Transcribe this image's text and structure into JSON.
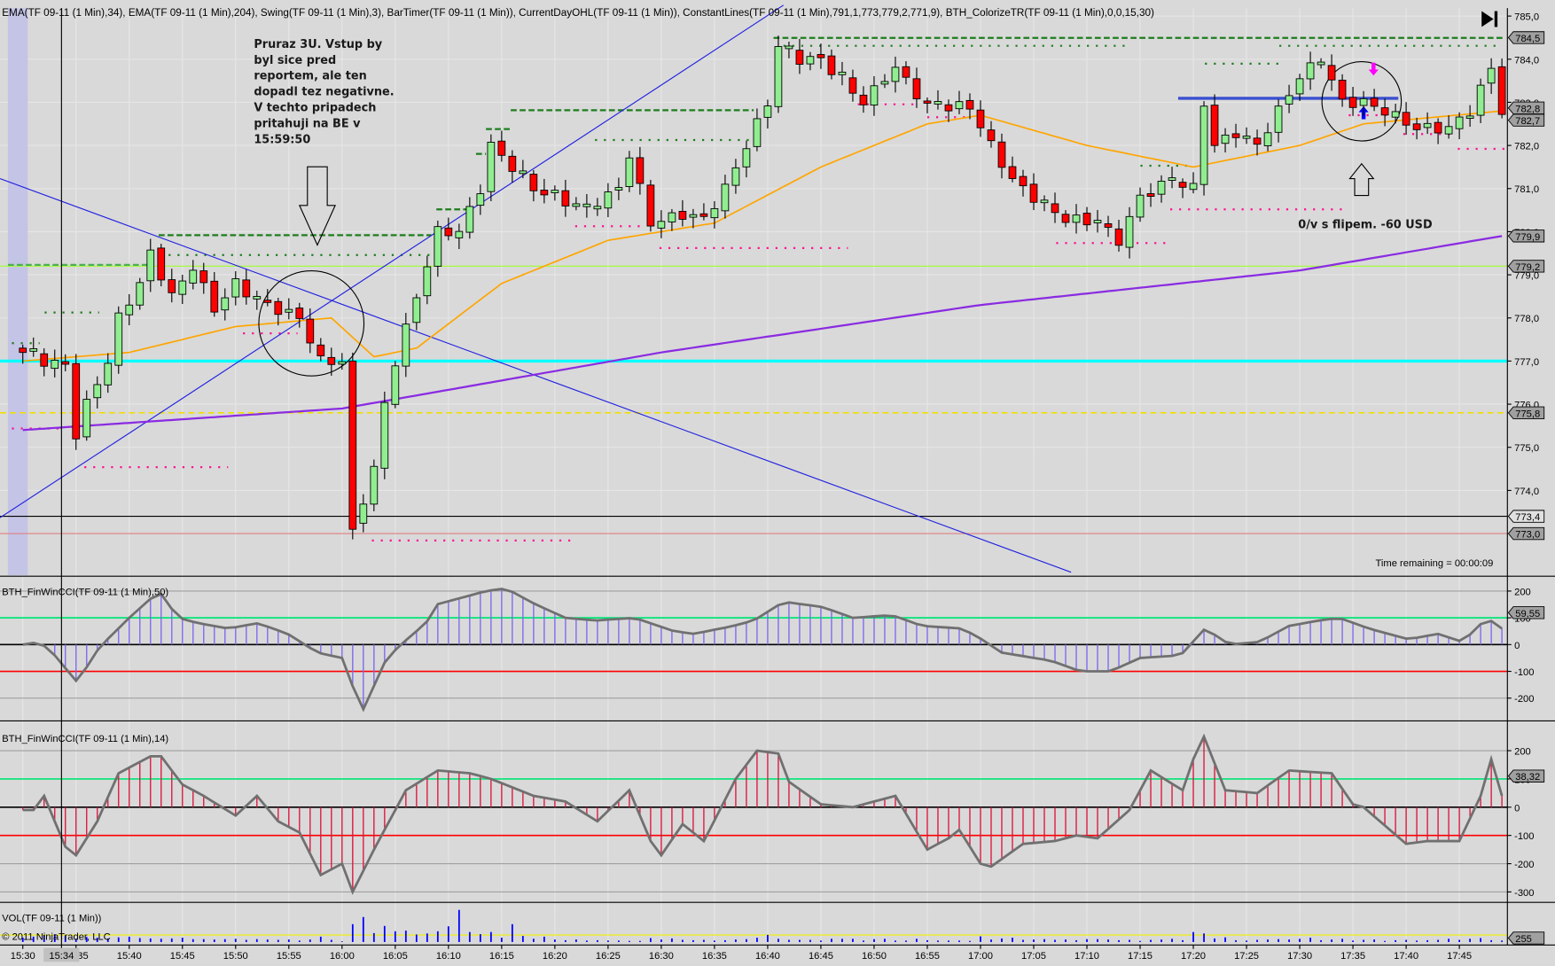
{
  "header": "EMA(TF 09-11 (1 Min),34), EMA(TF 09-11 (1 Min),204), Swing(TF 09-11 (1 Min),3), BarTimer(TF 09-11 (1 Min)), CurrentDayOHL(TF 09-11 (1 Min)), ConstantLines(TF 09-11 (1 Min),791,1,773,779,2,771,9), BTH_ColorizeTR(TF 09-11 (1 Min),0,0,15,30)",
  "annotation_left": [
    "Pruraz 3U. Vstup by",
    "byl sice pred",
    "reportem, ale ten",
    "dopadl tez negativne.",
    "V techto pripadech",
    "pritahuji na BE v",
    "15:59:50"
  ],
  "annotation_right": "0/v s flipem. -60 USD",
  "time_remaining": "Time remaining = 00:00:09",
  "copyright": "© 2011 NinjaTrader, LLC",
  "cursor_time": "15:34",
  "icons": {
    "scroll_end": "skip-to-end-icon"
  },
  "colors": {
    "up": "#90ee90",
    "down": "#ff0000",
    "ema34": "#ffa500",
    "ema204": "#8a2be2",
    "cyan": "#00ffff",
    "cci1": "#7b68ee",
    "cci2": "#dc143c"
  },
  "chart_data": [
    {
      "type": "candlestick",
      "title": "TF 09-11 (1 Min)",
      "x_start": "15:30",
      "bar_minutes": 1,
      "ylim": [
        772.7,
        785.2
      ],
      "y_ticks": [
        "785,0",
        "784,0",
        "783,0",
        "782,0",
        "781,0",
        "780,0",
        "779,0",
        "778,0",
        "777,0",
        "776,0",
        "775,0",
        "774,0"
      ],
      "y_tick_values": [
        785,
        784,
        783,
        782,
        781,
        780,
        779,
        778,
        777,
        776,
        775,
        774
      ],
      "price_markers": [
        {
          "label": "784,5",
          "value": 784.5,
          "color": "#a0a0a0"
        },
        {
          "label": "782,8",
          "value": 782.8,
          "color": "#a0a0a0"
        },
        {
          "label": "782,7",
          "value": 782.7,
          "color": "#a0a0a0"
        },
        {
          "label": "779,9",
          "value": 779.9,
          "color": "#a0a0a0"
        },
        {
          "label": "779,2",
          "value": 779.2,
          "color": "#a0a0a0"
        },
        {
          "label": "775,8",
          "value": 775.8,
          "color": "#a0a0a0"
        },
        {
          "label": "773,4",
          "value": 773.4,
          "color": "#e0e0e0"
        },
        {
          "label": "773,0",
          "value": 773.0,
          "color": "#a0a0a0"
        }
      ],
      "close_keypoints": [
        [
          0,
          777.2
        ],
        [
          2,
          777.0
        ],
        [
          4,
          776.9
        ],
        [
          5,
          775.3
        ],
        [
          6,
          776.0
        ],
        [
          8,
          777.0
        ],
        [
          9,
          778.0
        ],
        [
          11,
          778.8
        ],
        [
          12,
          779.5
        ],
        [
          14,
          778.5
        ],
        [
          16,
          779.2
        ],
        [
          18,
          778.2
        ],
        [
          20,
          778.8
        ],
        [
          22,
          778.4
        ],
        [
          24,
          778.2
        ],
        [
          26,
          778.0
        ],
        [
          28,
          777.0
        ],
        [
          30,
          777.0
        ],
        [
          31,
          773.1
        ],
        [
          33,
          774.5
        ],
        [
          34,
          776.0
        ],
        [
          35,
          777.0
        ],
        [
          37,
          778.5
        ],
        [
          39,
          780.0
        ],
        [
          41,
          780.0
        ],
        [
          43,
          781.0
        ],
        [
          44,
          782.0
        ],
        [
          46,
          781.5
        ],
        [
          48,
          781.0
        ],
        [
          50,
          780.8
        ],
        [
          53,
          780.5
        ],
        [
          56,
          781.0
        ],
        [
          57,
          781.8
        ],
        [
          59,
          780.2
        ],
        [
          62,
          780.4
        ],
        [
          64,
          780.3
        ],
        [
          66,
          781.0
        ],
        [
          68,
          782.0
        ],
        [
          70,
          783.0
        ],
        [
          71,
          784.3
        ],
        [
          73,
          784.0
        ],
        [
          75,
          784.0
        ],
        [
          77,
          783.5
        ],
        [
          79,
          783.0
        ],
        [
          82,
          783.8
        ],
        [
          84,
          783.2
        ],
        [
          85,
          782.9
        ],
        [
          89,
          782.9
        ],
        [
          91,
          782.0
        ],
        [
          93,
          781.2
        ],
        [
          96,
          780.6
        ],
        [
          98,
          780.3
        ],
        [
          101,
          780.2
        ],
        [
          103,
          779.8
        ],
        [
          105,
          780.8
        ],
        [
          108,
          781.2
        ],
        [
          110,
          781.0
        ],
        [
          111,
          783.0
        ],
        [
          112,
          782.0
        ],
        [
          114,
          782.3
        ],
        [
          116,
          782.0
        ],
        [
          118,
          782.8
        ],
        [
          120,
          783.6
        ],
        [
          122,
          784.0
        ],
        [
          124,
          783.0
        ],
        [
          126,
          783.0
        ],
        [
          128,
          782.8
        ],
        [
          131,
          782.4
        ],
        [
          134,
          782.4
        ],
        [
          136,
          782.8
        ],
        [
          138,
          783.8
        ],
        [
          139,
          782.8
        ]
      ],
      "ema34_keypoints": [
        [
          0,
          777.0
        ],
        [
          10,
          777.2
        ],
        [
          20,
          777.8
        ],
        [
          29,
          778.0
        ],
        [
          33,
          777.1
        ],
        [
          37,
          777.3
        ],
        [
          45,
          778.8
        ],
        [
          55,
          779.8
        ],
        [
          65,
          780.2
        ],
        [
          75,
          781.5
        ],
        [
          85,
          782.5
        ],
        [
          90,
          782.7
        ],
        [
          100,
          782.0
        ],
        [
          110,
          781.5
        ],
        [
          120,
          782.0
        ],
        [
          126,
          782.5
        ],
        [
          139,
          782.8
        ]
      ],
      "ema204_keypoints": [
        [
          0,
          775.4
        ],
        [
          30,
          775.9
        ],
        [
          60,
          777.2
        ],
        [
          90,
          778.3
        ],
        [
          120,
          779.1
        ],
        [
          139,
          779.9
        ]
      ],
      "constant_lines": [
        {
          "value": 777.0,
          "color": "#00ffff"
        },
        {
          "value": 775.8,
          "color": "#f0e000",
          "dash": true
        },
        {
          "value": 773.0,
          "color": "#e08080"
        },
        {
          "value": 773.4,
          "color": "#000000"
        },
        {
          "value": 779.2,
          "color": "#a0ff30"
        }
      ]
    },
    {
      "type": "histogram-line",
      "title": "BTH_FinWinCCI(TF 09-11 (1 Min),50)",
      "ylim": [
        -270,
        260
      ],
      "y_ticks": [
        200,
        100,
        0,
        -100,
        -200
      ],
      "last_value": "59,55",
      "keypoints": [
        [
          0,
          0
        ],
        [
          1.6,
          10
        ],
        [
          3,
          -40
        ],
        [
          5.1,
          -140
        ],
        [
          7.2,
          -10
        ],
        [
          10,
          100
        ],
        [
          12.8,
          200
        ],
        [
          14.6,
          100
        ],
        [
          16.5,
          80
        ],
        [
          19.3,
          60
        ],
        [
          22.1,
          80
        ],
        [
          24.9,
          40
        ],
        [
          27.7,
          -30
        ],
        [
          30,
          -50
        ],
        [
          31.9,
          -250
        ],
        [
          34.2,
          -50
        ],
        [
          36.1,
          20
        ],
        [
          37.9,
          80
        ],
        [
          38.9,
          150
        ],
        [
          41.7,
          180
        ],
        [
          43.5,
          200
        ],
        [
          45.4,
          210
        ],
        [
          48.2,
          150
        ],
        [
          51,
          100
        ],
        [
          53.8,
          90
        ],
        [
          57.5,
          100
        ],
        [
          61.2,
          50
        ],
        [
          63.1,
          40
        ],
        [
          66.8,
          70
        ],
        [
          68.7,
          90
        ],
        [
          71.5,
          160
        ],
        [
          75.2,
          140
        ],
        [
          78,
          100
        ],
        [
          81.7,
          110
        ],
        [
          84.5,
          70
        ],
        [
          88.3,
          60
        ],
        [
          90.1,
          20
        ],
        [
          92,
          -30
        ],
        [
          96.6,
          -60
        ],
        [
          99.4,
          -100
        ],
        [
          102.2,
          -100
        ],
        [
          105,
          -50
        ],
        [
          108.8,
          -40
        ],
        [
          111.1,
          60
        ],
        [
          113.4,
          0
        ],
        [
          116.2,
          10
        ],
        [
          119,
          70
        ],
        [
          121.8,
          90
        ],
        [
          123.7,
          100
        ],
        [
          126.5,
          60
        ],
        [
          130.2,
          20
        ],
        [
          133,
          40
        ],
        [
          135.3,
          10
        ],
        [
          137.6,
          100
        ],
        [
          139,
          60
        ]
      ]
    },
    {
      "type": "histogram-line",
      "title": "BTH_FinWinCCI(TF 09-11 (1 Min),14)",
      "ylim": [
        -330,
        290
      ],
      "y_ticks": [
        200,
        100,
        0,
        -100,
        -200,
        -300
      ],
      "last_value": "38,32",
      "keypoints": [
        [
          0,
          -10
        ],
        [
          1,
          -10
        ],
        [
          2,
          40
        ],
        [
          4,
          -140
        ],
        [
          5,
          -170
        ],
        [
          7,
          -50
        ],
        [
          9,
          120
        ],
        [
          12,
          180
        ],
        [
          13,
          180
        ],
        [
          15,
          80
        ],
        [
          17,
          40
        ],
        [
          20,
          -30
        ],
        [
          22,
          40
        ],
        [
          24,
          -50
        ],
        [
          26,
          -90
        ],
        [
          28,
          -240
        ],
        [
          30,
          -200
        ],
        [
          31,
          -300
        ],
        [
          33,
          -150
        ],
        [
          36,
          60
        ],
        [
          39,
          130
        ],
        [
          42,
          120
        ],
        [
          44,
          100
        ],
        [
          48,
          40
        ],
        [
          51,
          20
        ],
        [
          54,
          -50
        ],
        [
          57,
          60
        ],
        [
          59,
          -120
        ],
        [
          60,
          -170
        ],
        [
          62,
          -60
        ],
        [
          64,
          -120
        ],
        [
          67,
          100
        ],
        [
          69,
          200
        ],
        [
          71,
          190
        ],
        [
          72,
          90
        ],
        [
          75,
          10
        ],
        [
          78,
          0
        ],
        [
          82,
          40
        ],
        [
          85,
          -150
        ],
        [
          87,
          -110
        ],
        [
          88,
          -80
        ],
        [
          90,
          -200
        ],
        [
          91,
          -210
        ],
        [
          94,
          -130
        ],
        [
          97,
          -120
        ],
        [
          99,
          -100
        ],
        [
          101,
          -110
        ],
        [
          104,
          -10
        ],
        [
          106,
          130
        ],
        [
          109,
          60
        ],
        [
          110,
          170
        ],
        [
          111,
          250
        ],
        [
          113,
          60
        ],
        [
          116,
          50
        ],
        [
          119,
          130
        ],
        [
          123,
          120
        ],
        [
          125,
          10
        ],
        [
          126,
          0
        ],
        [
          130,
          -130
        ],
        [
          132,
          -120
        ],
        [
          135,
          -120
        ],
        [
          137,
          40
        ],
        [
          138,
          170
        ],
        [
          139,
          40
        ]
      ]
    },
    {
      "type": "bar",
      "title": "VOL(TF 09-11 (1 Min))",
      "last_value": "255",
      "values": [
        120,
        150,
        200,
        220,
        180,
        90,
        140,
        120,
        100,
        130,
        150,
        110,
        100,
        90,
        100,
        120,
        80,
        80,
        70,
        80,
        90,
        60,
        80,
        70,
        60,
        70,
        40,
        70,
        150,
        60,
        20,
        500,
        700,
        250,
        450,
        300,
        320,
        210,
        240,
        300,
        440,
        900,
        280,
        220,
        280,
        120,
        500,
        170,
        90,
        150,
        70,
        50,
        70,
        40,
        50,
        40,
        40,
        30,
        30,
        110,
        70,
        100,
        60,
        50,
        60,
        40,
        50,
        70,
        80,
        120,
        200,
        90,
        60,
        60,
        60,
        40,
        90,
        90,
        90,
        40,
        80,
        90,
        40,
        40,
        90,
        50,
        40,
        40,
        40,
        30,
        160,
        70,
        100,
        120,
        60,
        70,
        80,
        60,
        70,
        50,
        80,
        80,
        70,
        50,
        60,
        30,
        60,
        70,
        90,
        50,
        280,
        240,
        100,
        130,
        50,
        40,
        60,
        70,
        80,
        70,
        90,
        120,
        50,
        70,
        90,
        40,
        60,
        70,
        30,
        50,
        60,
        40,
        50,
        60,
        90,
        60,
        90,
        110,
        50,
        40
      ]
    }
  ],
  "time_axis": [
    "15:30",
    "15:35",
    "15:40",
    "15:45",
    "15:50",
    "15:55",
    "16:00",
    "16:05",
    "16:10",
    "16:15",
    "16:20",
    "16:25",
    "16:30",
    "16:35",
    "16:40",
    "16:45",
    "16:50",
    "16:55",
    "17:00",
    "17:05",
    "17:10",
    "17:15",
    "17:20",
    "17:25",
    "17:30",
    "17:35",
    "17:40",
    "17:45"
  ]
}
